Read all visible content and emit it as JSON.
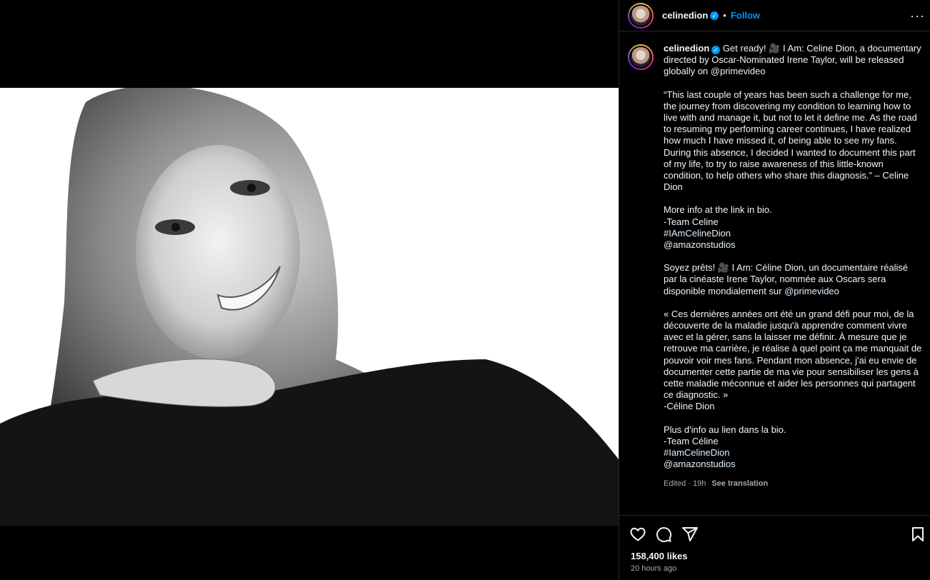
{
  "post": {
    "username": "celinedion",
    "verified_mark": "✓",
    "separator": "•",
    "follow_label": "Follow",
    "more_label": "···"
  },
  "caption": {
    "username": "celinedion",
    "p1": "Get ready! 🎥 I Am: Celine Dion, a documentary directed by Oscar-Nominated Irene Taylor, will be released globally on ",
    "p1_link": "@primevideo",
    "p2": "“This last couple of years has been such a challenge for me, the journey from discovering my condition to learning how to live with and manage it, but not to let it define me. As the road to resuming my performing career continues, I have realized how much I have missed it, of being able to see my fans. During this absence, I decided I wanted to document this part of my life, to try to raise awareness of this little-known condition, to help others who share this diagnosis.” – Celine Dion",
    "p3_line1": "More info at the link in bio.",
    "p3_line2": "-Team Celine",
    "p3_tag": "#IAmCelineDion",
    "p3_mention": "@amazonstudios",
    "p4": "Soyez prêts! 🎥 I Am: Céline Dion, un documentaire réalisé par la cinéaste Irene Taylor, nommée aux Oscars sera disponible mondialement sur ",
    "p4_link": "@primevideo",
    "p5": "« Ces dernières années ont été un grand défi pour moi, de la découverte de la maladie jusqu'à apprendre comment vivre avec et la gérer, sans la laisser me définir. À mesure que je retrouve ma carrière, je réalise à quel point ça me manquait de pouvoir voir mes fans. Pendant mon absence, j'ai eu envie de documenter cette partie de ma vie pour sensibiliser les gens à cette maladie méconnue et aider les personnes qui partagent ce diagnostic. »",
    "p5_sign": "-Céline Dion",
    "p6_line1": "Plus d'info au lien dans la bio.",
    "p6_line2": "-Team Céline",
    "p6_tag": "#IamCelineDion",
    "p6_mention": "@amazonstudios",
    "edited": "Edited · 19h",
    "see_translation": "See translation"
  },
  "stats": {
    "likes": "158,400 likes",
    "time": "20 hours ago"
  },
  "icons": {
    "like": "heart-icon",
    "comment": "comment-icon",
    "share": "share-icon",
    "save": "bookmark-icon",
    "more": "more-options-icon",
    "verified": "verified-badge-icon"
  },
  "colors": {
    "link": "#0095f6",
    "background": "#000000",
    "secondary_text": "#a8a8a8"
  }
}
